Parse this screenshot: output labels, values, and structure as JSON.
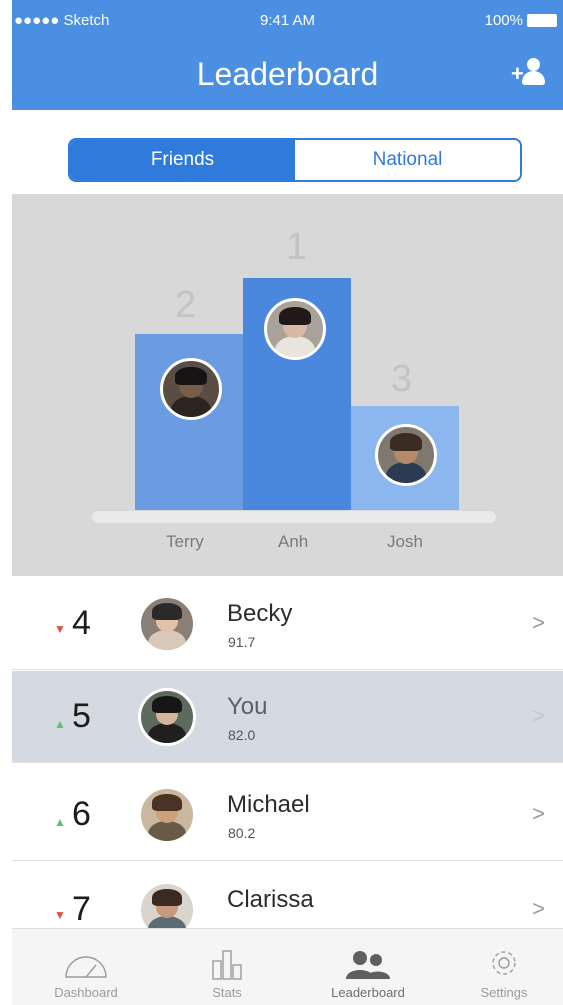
{
  "status_bar": {
    "carrier": "●●●●● Sketch",
    "time": "9:41 AM",
    "battery": "100%"
  },
  "header": {
    "title": "Leaderboard",
    "add_user_icon": "add-user-icon"
  },
  "segments": {
    "friends": "Friends",
    "national": "National",
    "selected": "Friends"
  },
  "podium": {
    "first": {
      "rank": "1",
      "name": "Anh"
    },
    "second": {
      "rank": "2",
      "name": "Terry"
    },
    "third": {
      "rank": "3",
      "name": "Josh"
    }
  },
  "list": [
    {
      "rank": "4",
      "name": "Becky",
      "score": "91.7",
      "trend": "down"
    },
    {
      "rank": "5",
      "name": "You",
      "score": "82.0",
      "trend": "up"
    },
    {
      "rank": "6",
      "name": "Michael",
      "score": "80.2",
      "trend": "up"
    },
    {
      "rank": "7",
      "name": "Clarissa",
      "score": "",
      "trend": "down"
    }
  ],
  "tabs": [
    {
      "label": "Dashboard",
      "icon": "gauge-icon"
    },
    {
      "label": "Stats",
      "icon": "bar-chart-icon"
    },
    {
      "label": "Leaderboard",
      "icon": "people-icon",
      "active": true
    },
    {
      "label": "Settings",
      "icon": "gear-icon"
    }
  ],
  "colors": {
    "primary": "#4a8fe2",
    "accent": "#2f7bdc",
    "trend_down": "#e2513e",
    "trend_up": "#5bc46c"
  }
}
